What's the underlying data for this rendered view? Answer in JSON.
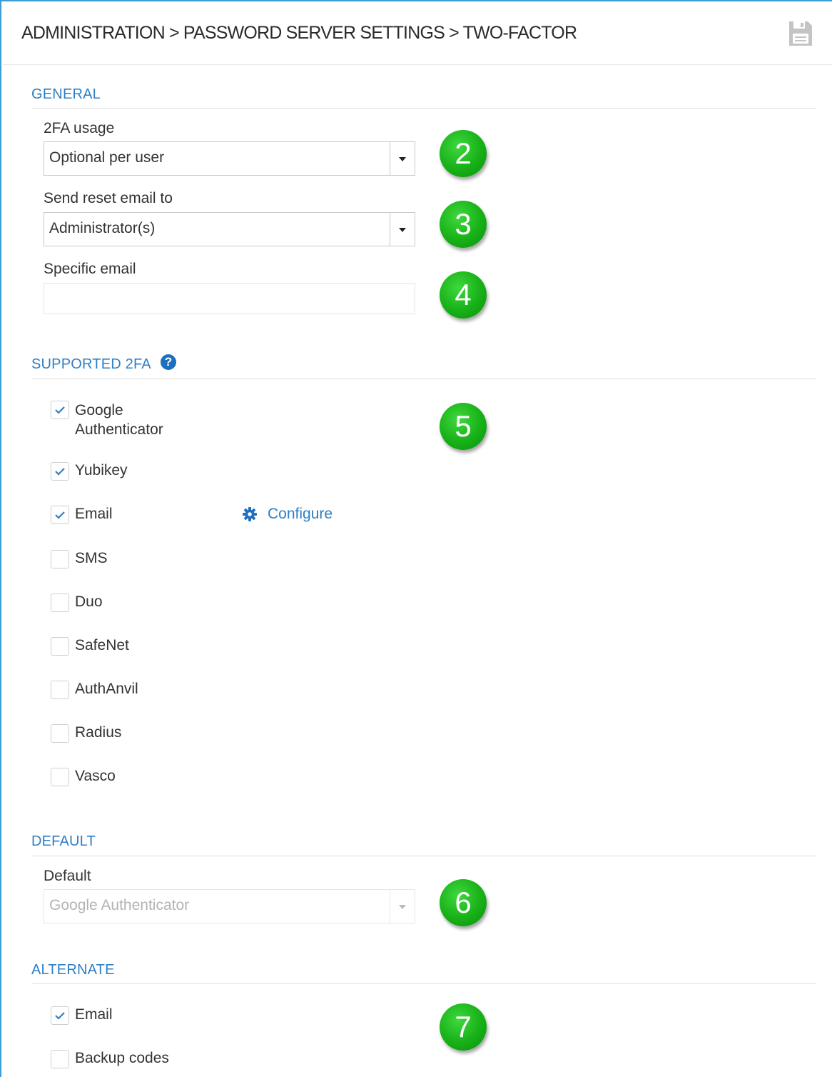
{
  "header": {
    "breadcrumb": "ADMINISTRATION > PASSWORD SERVER SETTINGS > TWO-FACTOR",
    "save_icon": "save-icon"
  },
  "general": {
    "title": "GENERAL",
    "usage_label": "2FA usage",
    "usage_value": "Optional per user",
    "reset_label": "Send reset email to",
    "reset_value": "Administrator(s)",
    "specific_email_label": "Specific email",
    "specific_email_value": ""
  },
  "supported": {
    "title": "SUPPORTED 2FA",
    "help_icon": "?",
    "configure_label": "Configure",
    "items": [
      {
        "label": "Google Authenticator",
        "checked": true
      },
      {
        "label": "Yubikey",
        "checked": true
      },
      {
        "label": "Email",
        "checked": true
      },
      {
        "label": "SMS",
        "checked": false
      },
      {
        "label": "Duo",
        "checked": false
      },
      {
        "label": "SafeNet",
        "checked": false
      },
      {
        "label": "AuthAnvil",
        "checked": false
      },
      {
        "label": "Radius",
        "checked": false
      },
      {
        "label": "Vasco",
        "checked": false
      }
    ]
  },
  "default": {
    "title": "DEFAULT",
    "label": "Default",
    "value": "Google Authenticator",
    "disabled": true
  },
  "alternate": {
    "title": "ALTERNATE",
    "items": [
      {
        "label": "Email",
        "checked": true
      },
      {
        "label": "Backup codes",
        "checked": false
      }
    ]
  },
  "annotations": [
    "2",
    "3",
    "4",
    "5",
    "6",
    "7"
  ],
  "colors": {
    "accent": "#2f7ec4",
    "frame": "#3f9bd3",
    "badge": "#17b117"
  }
}
